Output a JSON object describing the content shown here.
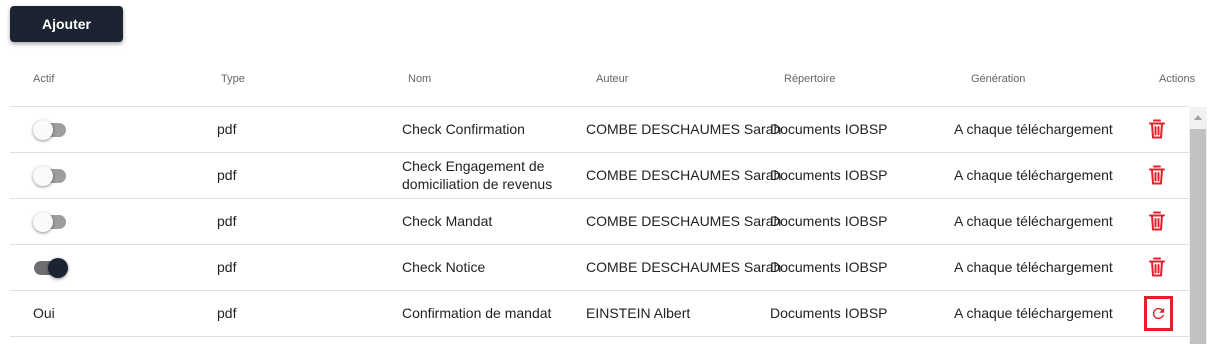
{
  "toolbar": {
    "add_label": "Ajouter"
  },
  "table": {
    "headers": {
      "actif": "Actif",
      "type": "Type",
      "nom": "Nom",
      "auteur": "Auteur",
      "repertoire": "Répertoire",
      "generation": "Génération",
      "actions": "Actions"
    },
    "rows": [
      {
        "actif": false,
        "type": "pdf",
        "nom": "Check Confirmation",
        "auteur": "COMBE DESCHAUMES Sarah",
        "repertoire": "Documents IOBSP",
        "generation": "A chaque téléchargement",
        "action_icon": "trash-icon"
      },
      {
        "actif": false,
        "type": "pdf",
        "nom": "Check Engagement de domiciliation de revenus",
        "auteur": "COMBE DESCHAUMES Sarah",
        "repertoire": "Documents IOBSP",
        "generation": "A chaque téléchargement",
        "action_icon": "trash-icon"
      },
      {
        "actif": false,
        "type": "pdf",
        "nom": "Check Mandat",
        "auteur": "COMBE DESCHAUMES Sarah",
        "repertoire": "Documents IOBSP",
        "generation": "A chaque téléchargement",
        "action_icon": "trash-icon"
      },
      {
        "actif": true,
        "type": "pdf",
        "nom": "Check Notice",
        "auteur": "COMBE DESCHAUMES Sarah",
        "repertoire": "Documents IOBSP",
        "generation": "A chaque téléchargement",
        "action_icon": "trash-icon"
      },
      {
        "actif_text": "Oui",
        "type": "pdf",
        "nom": "Confirmation de mandat",
        "auteur": "EINSTEIN Albert",
        "repertoire": "Documents IOBSP",
        "generation": "A chaque téléchargement",
        "action_icon": "restore-icon"
      }
    ]
  },
  "colors": {
    "button_bg": "#1c2331",
    "action_red": "#e0202a",
    "toggle_on": "#1c2331",
    "toggle_off_track": "#9e9e9e"
  }
}
